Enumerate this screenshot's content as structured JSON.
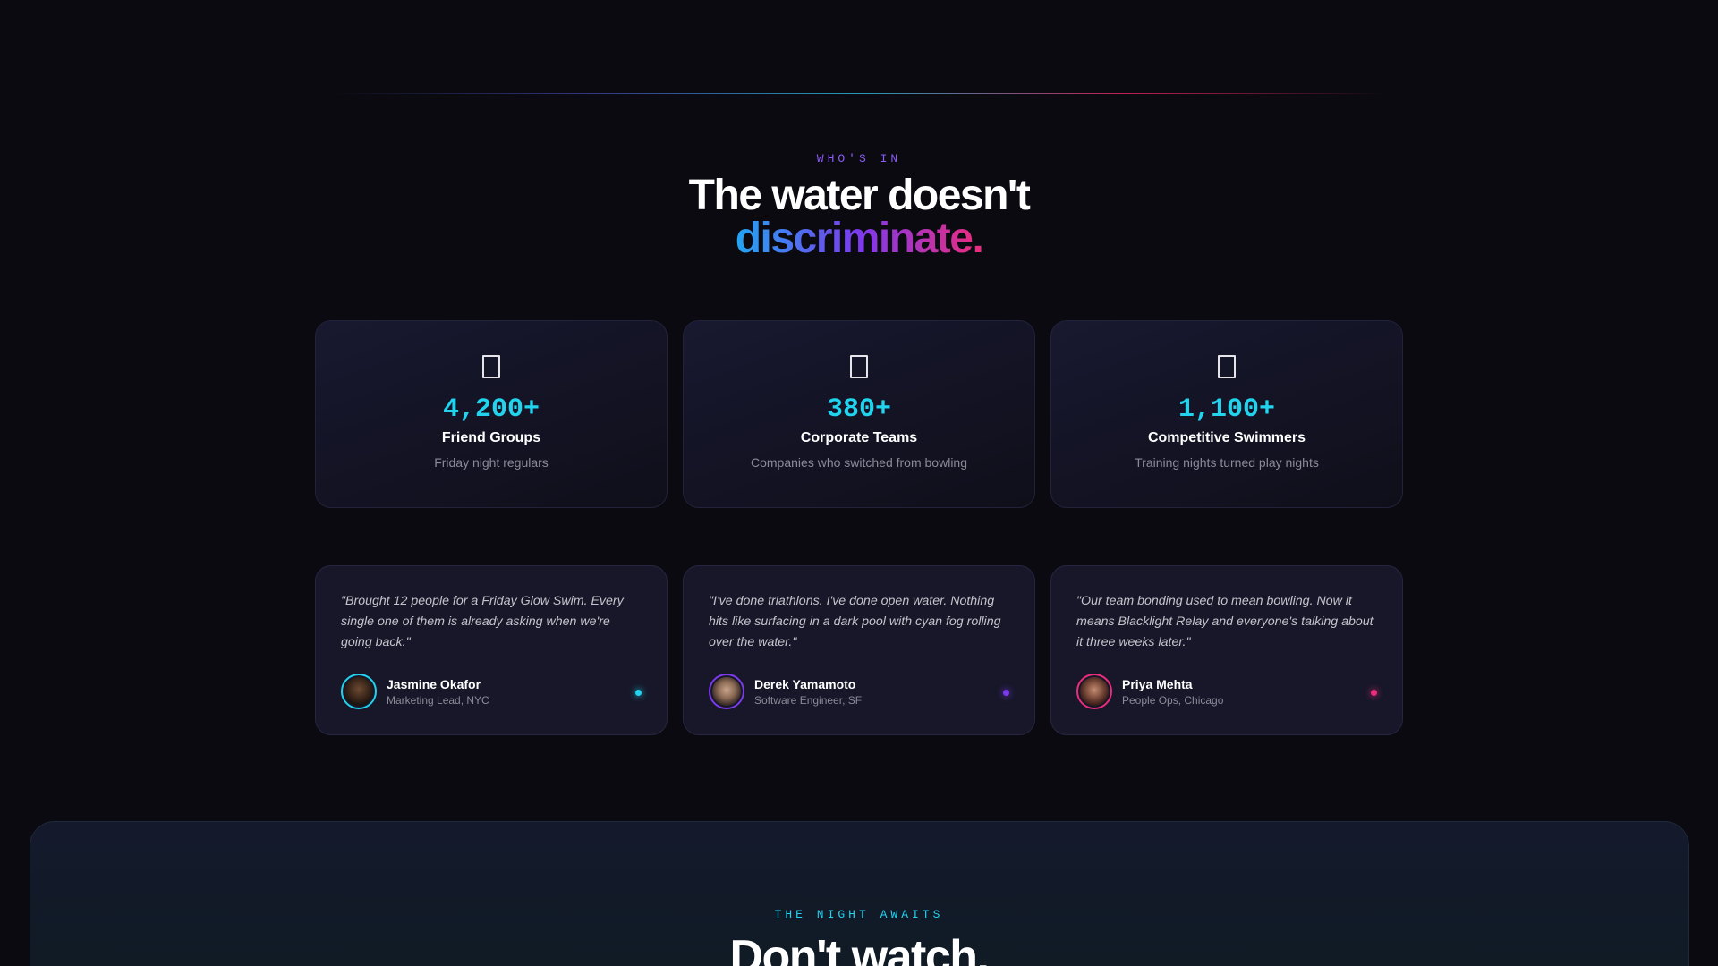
{
  "section": {
    "label": "WHO'S IN",
    "headline_line1": "The water doesn't",
    "headline_line2": "discriminate."
  },
  "stats": [
    {
      "icon": "square-icon",
      "value": "4,200+",
      "title": "Friend Groups",
      "subtitle": "Friday night regulars"
    },
    {
      "icon": "square-icon",
      "value": "380+",
      "title": "Corporate Teams",
      "subtitle": "Companies who switched from bowling"
    },
    {
      "icon": "square-icon",
      "value": "1,100+",
      "title": "Competitive Swimmers",
      "subtitle": "Training nights turned play nights"
    }
  ],
  "testimonials": [
    {
      "quote": "\"Brought 12 people for a Friday Glow Swim. Every single one of them is already asking when we're going back.\"",
      "name": "Jasmine Okafor",
      "role": "Marketing Lead, NYC",
      "accent": "#22d3ee"
    },
    {
      "quote": "\"I've done triathlons. I've done open water. Nothing hits like surfacing in a dark pool with cyan fog rolling over the water.\"",
      "name": "Derek Yamamoto",
      "role": "Software Engineer, SF",
      "accent": "#7c3aed"
    },
    {
      "quote": "\"Our team bonding used to mean bowling. Now it means Blacklight Relay and everyone's talking about it three weeks later.\"",
      "name": "Priya Mehta",
      "role": "People Ops, Chicago",
      "accent": "#ec2c7b"
    }
  ],
  "cta": {
    "label": "THE NIGHT AWAITS",
    "headline": "Don't watch."
  },
  "colors": {
    "background": "#0a0a10",
    "cyan": "#22d3ee",
    "violet": "#7c3aed",
    "pink": "#ec2c7b"
  }
}
